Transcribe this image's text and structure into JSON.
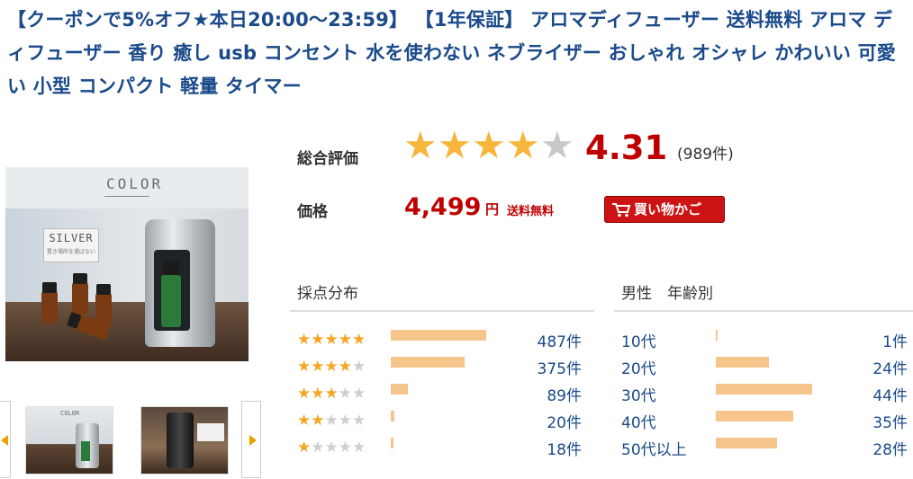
{
  "product": {
    "title": "【クーポンで5%オフ★本日20:00～23:59】 【1年保証】 アロマディフューザー 送料無料 アロマ ディフューザー 香り 癒し usb コンセント 水を使わない ネブライザー おしゃれ オシャレ かわいい 可愛い 小型 コンパクト 軽量 タイマー",
    "image_label": "COLOR",
    "image_card_label": "SILVER",
    "image_card_sub": "置き場所を選ばない"
  },
  "rating": {
    "label": "総合評価",
    "score": "4.31",
    "score_value": 4.31,
    "count": "(989件)"
  },
  "price": {
    "label": "価格",
    "amount": "4,499",
    "unit": "円",
    "shipping": "送料無料",
    "cart_button": "買い物かご"
  },
  "distribution": {
    "heading": "採点分布",
    "rows": [
      {
        "stars": 5,
        "fraction": 1.0,
        "count": "487件"
      },
      {
        "stars": 4,
        "fraction": 0.77,
        "count": "375件"
      },
      {
        "stars": 3,
        "fraction": 0.18,
        "count": "89件"
      },
      {
        "stars": 2,
        "fraction": 0.04,
        "count": "20件"
      },
      {
        "stars": 1,
        "fraction": 0.03,
        "count": "18件"
      }
    ]
  },
  "age": {
    "heading": "男性　年齢別",
    "rows": [
      {
        "label": "10代",
        "fraction": 0.02,
        "count": "1件"
      },
      {
        "label": "20代",
        "fraction": 0.55,
        "count": "24件"
      },
      {
        "label": "30代",
        "fraction": 1.0,
        "count": "44件"
      },
      {
        "label": "40代",
        "fraction": 0.8,
        "count": "35件"
      },
      {
        "label": "50代以上",
        "fraction": 0.64,
        "count": "28件"
      }
    ]
  },
  "colors": {
    "title": "#1a4a8a",
    "price_red": "#bf0000",
    "bar": "#f5c58b",
    "star_gold": "#f7b53b",
    "star_grey": "#c8c8c8",
    "arrow": "#e8a100"
  },
  "icons": {
    "cart": "shopping-cart-icon",
    "prev": "chevron-left-icon",
    "next": "chevron-right-icon",
    "star": "star-icon"
  }
}
